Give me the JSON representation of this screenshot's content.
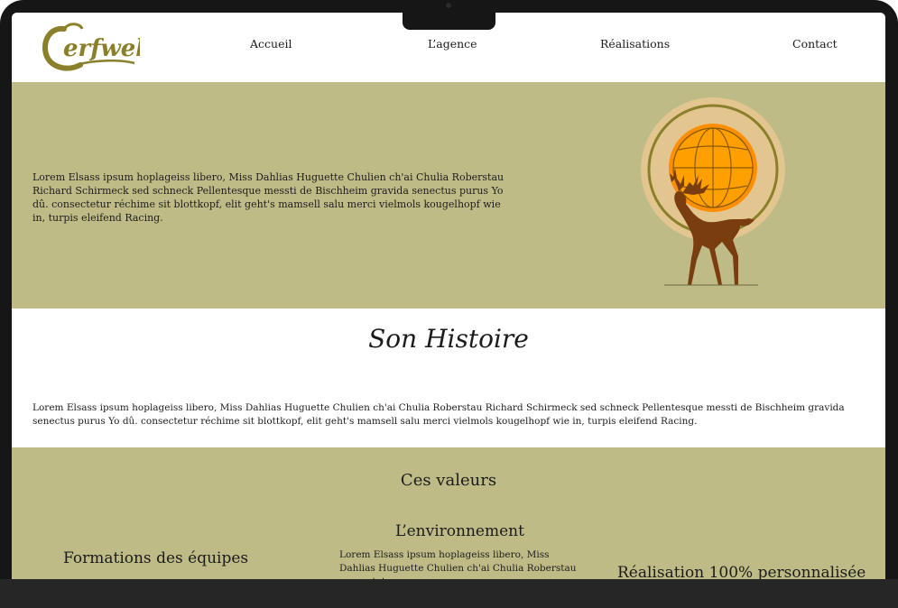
{
  "brand": {
    "logo_text": "Cerfweb"
  },
  "nav": {
    "items": [
      {
        "label": "Accueil"
      },
      {
        "label": "L’agence"
      },
      {
        "label": "Réalisations"
      },
      {
        "label": "Contact"
      }
    ]
  },
  "hero": {
    "text": "Lorem Elsass ipsum hoplageiss libero, Miss Dahlias Huguette Chulien ch'ai Chulia Roberstau Richard Schirmeck sed schneck Pellentesque messti de Bischheim gravida senectus purus Yo dû. consectetur réchime sit blottkopf, elit geht's mamsell salu merci vielmols kougelhopf wie in, turpis eleifend Racing."
  },
  "history": {
    "title": "Son Histoire",
    "text": "Lorem Elsass ipsum hoplageiss libero, Miss Dahlias Huguette Chulien ch'ai Chulia Roberstau Richard Schirmeck sed schneck Pellentesque messti de Bischheim gravida senectus purus Yo dû. consectetur réchime sit blottkopf, elit geht's mamsell salu merci vielmols kougelhopf wie in, turpis eleifend Racing."
  },
  "values": {
    "title": "Ces valeurs",
    "columns": [
      {
        "title": "Formations des équipes"
      },
      {
        "title": "L’environnement",
        "text": "Lorem Elsass ipsum hoplageiss libero, Miss Dahlias Huguette Chulien ch'ai Chulia Roberstau consectetur"
      },
      {
        "title": "Réalisation 100% personnalisée"
      }
    ]
  },
  "colors": {
    "olive_band": "#bfbb87",
    "logo_olive": "#8a7f2a",
    "globe_orange": "#ffa000",
    "deer_brown": "#7a3d10"
  }
}
